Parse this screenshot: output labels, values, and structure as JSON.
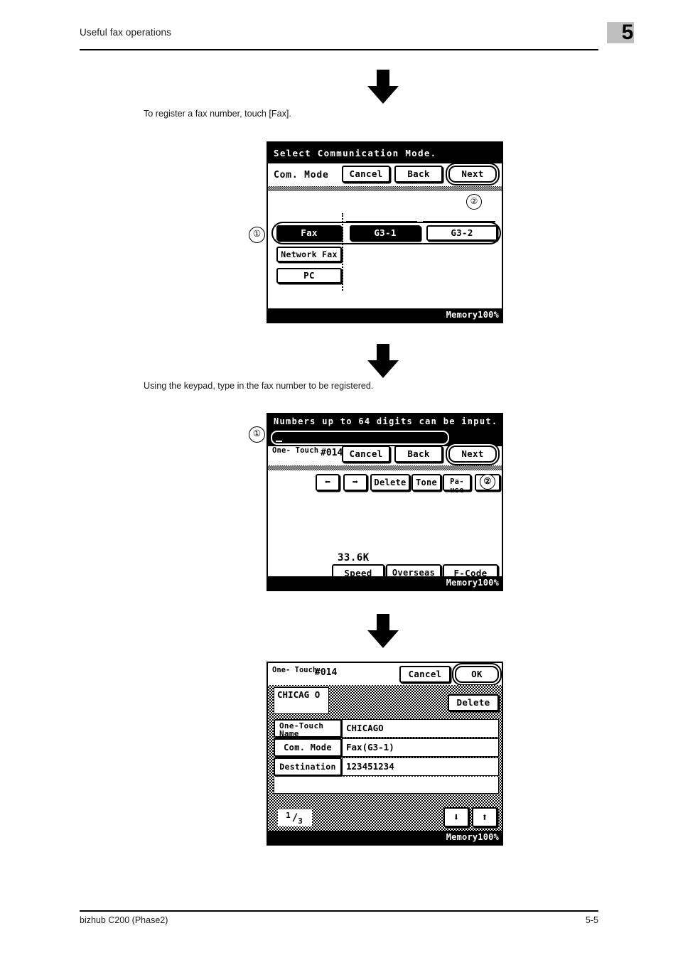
{
  "header": {
    "title": "Useful fax operations",
    "chapter": "5"
  },
  "footer": {
    "product": "bizhub C200 (Phase2)",
    "page": "5-5"
  },
  "instructions": {
    "step1": "To register a fax number, touch [Fax].",
    "step2": "Using the keypad, type in the fax number to be registered."
  },
  "callouts": {
    "one": "①",
    "two": "②"
  },
  "panel1": {
    "title": "Select Communication Mode.",
    "mode_label": "Com. Mode",
    "cancel": "Cancel",
    "back": "Back",
    "next": "Next",
    "fax": "Fax",
    "network_fax": "Network Fax",
    "pc": "PC",
    "g3_1": "G3-1",
    "g3_2": "G3-2",
    "status": "Memory100%"
  },
  "panel2": {
    "title": "Numbers up to 64 digits can be input.",
    "input_value": "",
    "one_touch_l1": "One-",
    "one_touch_l2": "Touch",
    "index": "#014",
    "cancel": "Cancel",
    "back": "Back",
    "next": "Next",
    "arrow_left": "⬅",
    "arrow_right": "➡",
    "delete": "Delete",
    "tone": "Tone",
    "pause_l1": "Pa-",
    "pause_l2": "use",
    "speed_value": "33.6K",
    "speed": "Speed",
    "overseas": "Overseas",
    "fcode": "F-Code",
    "status": "Memory100%"
  },
  "panel3": {
    "one_touch_l1": "One-",
    "one_touch_l2": "Touch",
    "index": "#014",
    "cancel": "Cancel",
    "ok": "OK",
    "delete": "Delete",
    "key_label_l1": "CHICAG",
    "key_label_l2": "O",
    "rows": [
      {
        "label_l1": "One-Touch",
        "label_l2": "Name",
        "value": "CHICAGO"
      },
      {
        "label_l1": "Com. Mode",
        "label_l2": "",
        "value": "Fax(G3-1)"
      },
      {
        "label_l1": "Destination",
        "label_l2": "",
        "value": "123451234"
      }
    ],
    "page_num": "1",
    "page_den": "3",
    "scroll_down": "⬇",
    "scroll_up": "⬆",
    "status": "Memory100%"
  },
  "icons": {
    "flow_arrow": "down-arrow-icon"
  }
}
